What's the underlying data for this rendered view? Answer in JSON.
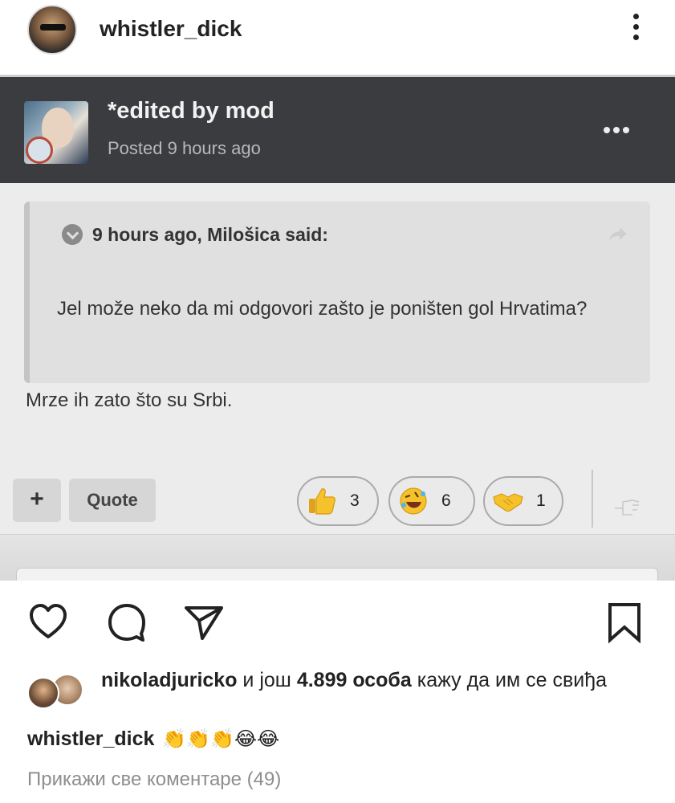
{
  "header": {
    "username": "whistler_dick",
    "more_icon": "vertical-dots-icon"
  },
  "post_image": {
    "forum": {
      "title": "*edited by mod",
      "meta": "Posted 9 hours ago",
      "menu_icon": "horizontal-dots-icon"
    },
    "quote": {
      "header": "9 hours ago, Milošica said:",
      "text": "Jel može neko da mi odgovori zašto je poništen gol Hrvatima?",
      "share_icon": "share-arrow-icon"
    },
    "reply": "Mrze ih zato što su Srbi.",
    "buttons": {
      "plus": "+",
      "quote": "Quote"
    },
    "reactions": [
      {
        "icon": "thumbs-up-icon",
        "count": "3"
      },
      {
        "icon": "rofl-icon",
        "count": "6"
      },
      {
        "icon": "handshake-icon",
        "count": "1"
      }
    ]
  },
  "actions": {
    "like_icon": "heart-icon",
    "comment_icon": "comment-icon",
    "share_icon": "paper-plane-icon",
    "save_icon": "bookmark-icon"
  },
  "likes": {
    "user": "nikoladjuricko",
    "middle": " и још ",
    "count": "4.899 особа",
    "suffix": " кажу да им се свиђа"
  },
  "caption": {
    "username": "whistler_dick",
    "emojis": "👏👏👏😂😂"
  },
  "view_comments": "Прикажи све коментаре (49)"
}
